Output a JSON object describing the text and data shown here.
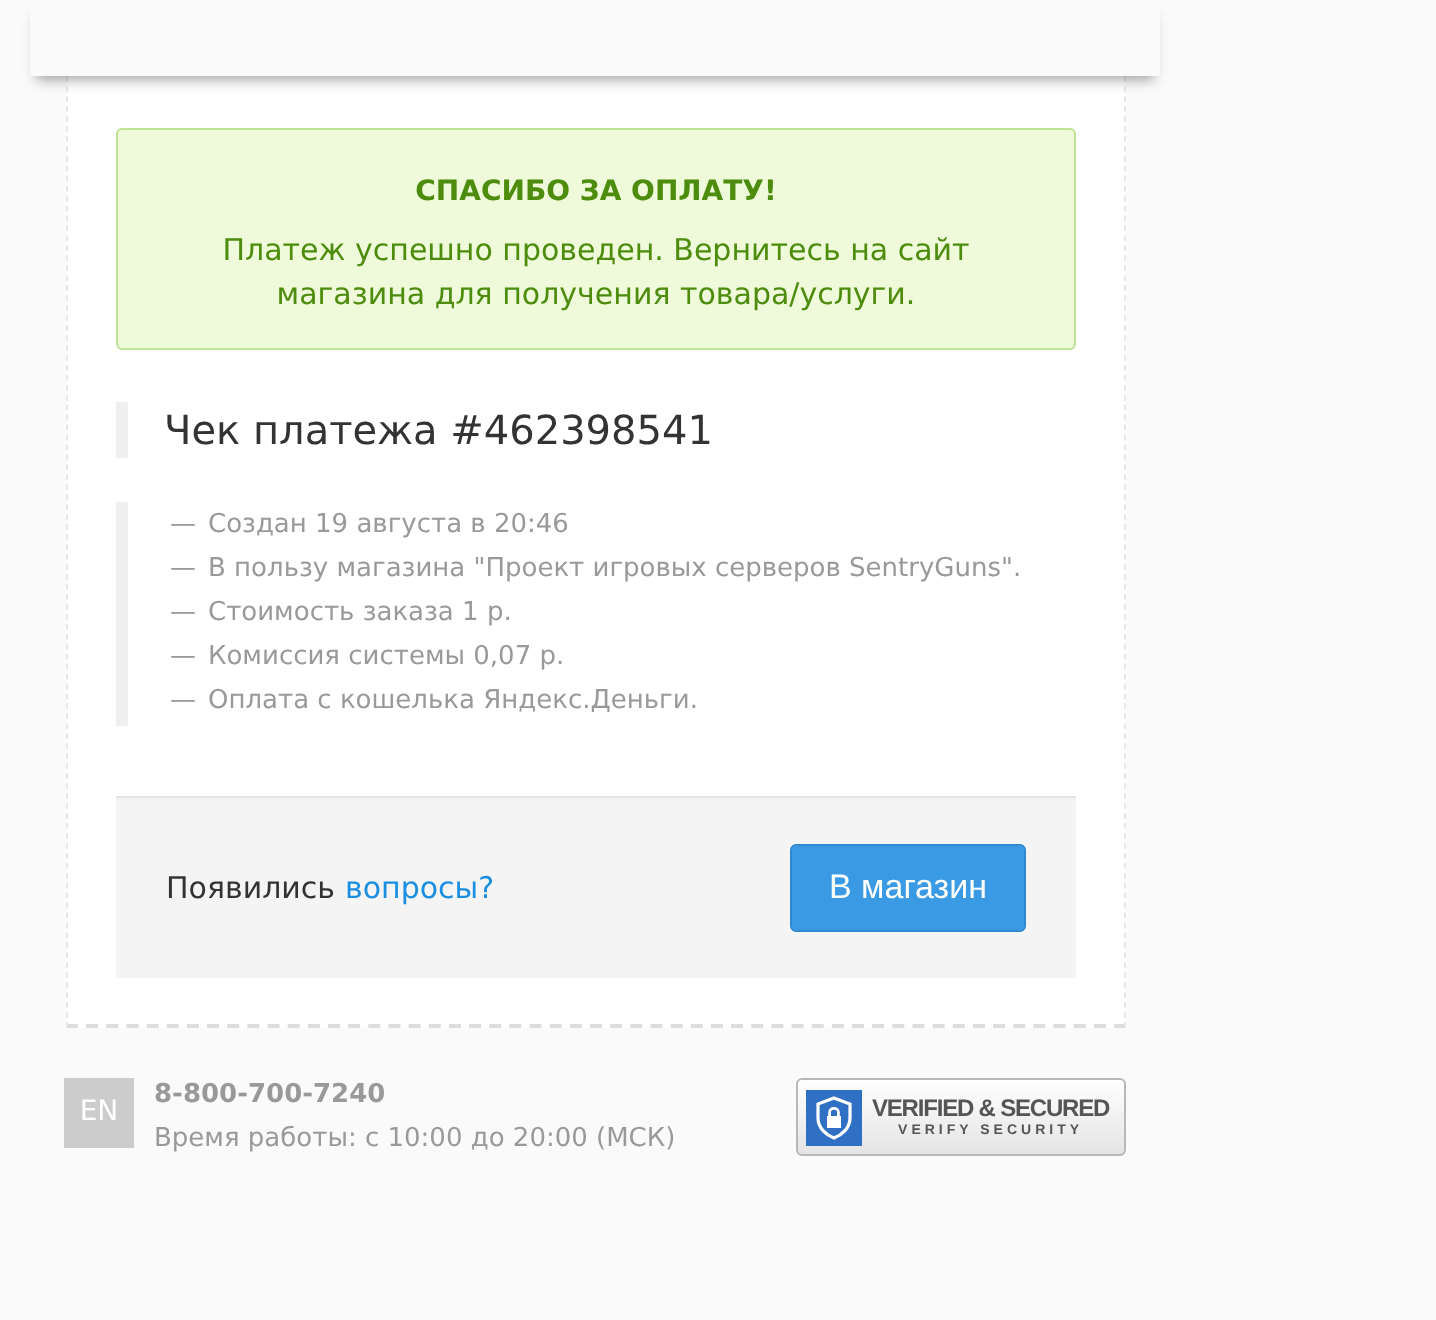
{
  "alert": {
    "title": "СПАСИБО ЗА ОПЛАТУ!",
    "message": "Платеж успешно проведен. Вернитесь на сайт магазина для получения товара/услуги."
  },
  "receipt": {
    "title": "Чек платежа #462398541",
    "details": [
      {
        "marker": "—",
        "text": "Создан 19 августа в 20:46"
      },
      {
        "marker": "—",
        "text": "В пользу магазина \"Проект игровых серверов SentryGuns\"."
      },
      {
        "marker": "—",
        "text": "Стоимость заказа 1 р."
      },
      {
        "marker": "—",
        "text": "Комиссия системы 0,07 р."
      },
      {
        "marker": "—",
        "text": "Оплата с кошелька Яндекс.Деньги."
      }
    ]
  },
  "help": {
    "text": "Появились",
    "link": "вопросы?"
  },
  "button": "В магазин",
  "footer": {
    "language": "EN",
    "phone": "8-800-700-7240",
    "hours": "Время работы: с 10:00 до 20:00 (МСК)",
    "security_badge": {
      "title": "VERIFIED & SECURED",
      "subtitle": "VERIFY SECURITY"
    }
  }
}
